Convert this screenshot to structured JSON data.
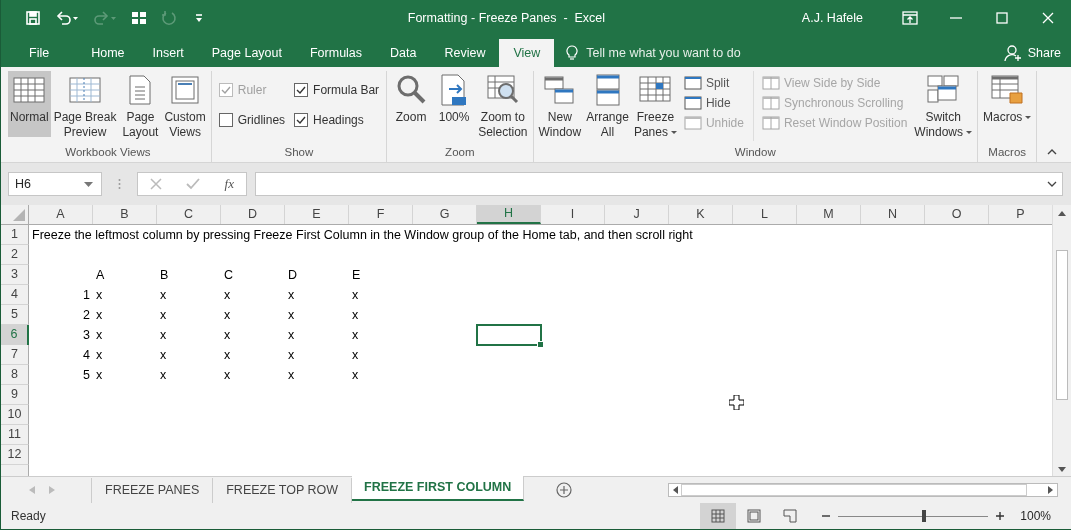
{
  "window": {
    "title": "Formatting - Freeze Panes  -  Excel",
    "user": "A.J. Hafele"
  },
  "quick_access": [
    {
      "kind": "save",
      "disabled": false
    },
    {
      "kind": "undo",
      "disabled": false
    },
    {
      "kind": "redo",
      "disabled": true
    },
    {
      "kind": "form",
      "disabled": false
    },
    {
      "kind": "refresh",
      "disabled": true
    },
    {
      "kind": "customize",
      "disabled": false
    }
  ],
  "ribbon_tabs": [
    {
      "label": "File",
      "selected": false
    },
    {
      "label": "Home",
      "selected": false
    },
    {
      "label": "Insert",
      "selected": false
    },
    {
      "label": "Page Layout",
      "selected": false
    },
    {
      "label": "Formulas",
      "selected": false
    },
    {
      "label": "Data",
      "selected": false
    },
    {
      "label": "Review",
      "selected": false
    },
    {
      "label": "View",
      "selected": true
    }
  ],
  "tell_me": {
    "placeholder": "Tell me what you want to do"
  },
  "share": "Share",
  "ribbon_groups": [
    {
      "label": "Workbook Views",
      "items": [
        {
          "kind": "large",
          "lines": [
            "Normal"
          ],
          "selected": true
        },
        {
          "kind": "large",
          "lines": [
            "Page Break",
            "Preview"
          ],
          "selected": false
        },
        {
          "kind": "large",
          "lines": [
            "Page",
            "Layout"
          ],
          "selected": false
        },
        {
          "kind": "large",
          "lines": [
            "Custom",
            "Views"
          ],
          "selected": false
        }
      ]
    },
    {
      "label": "Show",
      "items": [
        {
          "kind": "stack",
          "items": [
            {
              "label": "Ruler",
              "checked": true,
              "disabled": true
            },
            {
              "label": "Gridlines",
              "checked": false,
              "disabled": false
            }
          ]
        },
        {
          "kind": "stack",
          "items": [
            {
              "label": "Formula Bar",
              "checked": true,
              "disabled": false
            },
            {
              "label": "Headings",
              "checked": true,
              "disabled": false
            }
          ]
        }
      ]
    },
    {
      "label": "Zoom",
      "items": [
        {
          "kind": "large",
          "lines": [
            "Zoom"
          ],
          "selected": false
        },
        {
          "kind": "large",
          "lines": [
            "100%"
          ],
          "selected": false
        },
        {
          "kind": "large",
          "lines": [
            "Zoom to",
            "Selection"
          ],
          "selected": false
        }
      ]
    },
    {
      "label": "Window",
      "items": [
        {
          "kind": "large",
          "lines": [
            "New",
            "Window"
          ],
          "selected": false
        },
        {
          "kind": "large",
          "lines": [
            "Arrange",
            "All"
          ],
          "selected": false
        },
        {
          "kind": "large",
          "lines": [
            "Freeze",
            "Panes"
          ],
          "selected": false,
          "dropdown": true
        },
        {
          "kind": "small",
          "items": [
            {
              "label": "Split",
              "disabled": false
            },
            {
              "label": "Hide",
              "disabled": false
            },
            {
              "label": "Unhide",
              "disabled": true
            }
          ]
        },
        {
          "kind": "small",
          "items": [
            {
              "label": "View Side by Side",
              "disabled": true
            },
            {
              "label": "Synchronous Scrolling",
              "disabled": true
            },
            {
              "label": "Reset Window Position",
              "disabled": true
            }
          ]
        },
        {
          "kind": "large",
          "lines": [
            "Switch",
            "Windows"
          ],
          "selected": false,
          "dropdown": true
        }
      ]
    },
    {
      "label": "Macros",
      "items": [
        {
          "kind": "large",
          "lines": [
            "Macros"
          ],
          "selected": false,
          "dropdown": true
        }
      ]
    }
  ],
  "formula_bar": {
    "name_box": "H6",
    "function_button": "fx"
  },
  "columns": [
    {
      "label": "A",
      "selected": false
    },
    {
      "label": "B",
      "selected": false
    },
    {
      "label": "C",
      "selected": false
    },
    {
      "label": "D",
      "selected": false
    },
    {
      "label": "E",
      "selected": false
    },
    {
      "label": "F",
      "selected": false
    },
    {
      "label": "G",
      "selected": false
    },
    {
      "label": "H",
      "selected": true
    },
    {
      "label": "I",
      "selected": false
    },
    {
      "label": "J",
      "selected": false
    },
    {
      "label": "K",
      "selected": false
    },
    {
      "label": "L",
      "selected": false
    },
    {
      "label": "M",
      "selected": false
    },
    {
      "label": "N",
      "selected": false
    },
    {
      "label": "O",
      "selected": false
    },
    {
      "label": "P",
      "selected": false
    }
  ],
  "rows": [
    {
      "label": "1",
      "selected": false,
      "cells": [
        {
          "text": "Freeze the leftmost column by pressing Freeze First Column in the Window group of the Home tab, and then scroll right",
          "kind": "text"
        }
      ]
    },
    {
      "label": "2",
      "selected": false
    },
    {
      "label": "3",
      "selected": false,
      "cells": [
        null,
        {
          "text": "A",
          "kind": "text"
        },
        {
          "text": "B",
          "kind": "text"
        },
        {
          "text": "C",
          "kind": "text"
        },
        {
          "text": "D",
          "kind": "text"
        },
        {
          "text": "E",
          "kind": "text"
        }
      ]
    },
    {
      "label": "4",
      "selected": false,
      "cells": [
        {
          "text": "1",
          "kind": "number"
        },
        {
          "text": "x",
          "kind": "text"
        },
        {
          "text": "x",
          "kind": "text"
        },
        {
          "text": "x",
          "kind": "text"
        },
        {
          "text": "x",
          "kind": "text"
        },
        {
          "text": "x",
          "kind": "text"
        }
      ]
    },
    {
      "label": "5",
      "selected": false,
      "cells": [
        {
          "text": "2",
          "kind": "number"
        },
        {
          "text": "x",
          "kind": "text"
        },
        {
          "text": "x",
          "kind": "text"
        },
        {
          "text": "x",
          "kind": "text"
        },
        {
          "text": "x",
          "kind": "text"
        },
        {
          "text": "x",
          "kind": "text"
        }
      ]
    },
    {
      "label": "6",
      "selected": true,
      "cells": [
        {
          "text": "3",
          "kind": "number"
        },
        {
          "text": "x",
          "kind": "text"
        },
        {
          "text": "x",
          "kind": "text"
        },
        {
          "text": "x",
          "kind": "text"
        },
        {
          "text": "x",
          "kind": "text"
        },
        {
          "text": "x",
          "kind": "text"
        }
      ]
    },
    {
      "label": "7",
      "selected": false,
      "cells": [
        {
          "text": "4",
          "kind": "number"
        },
        {
          "text": "x",
          "kind": "text"
        },
        {
          "text": "x",
          "kind": "text"
        },
        {
          "text": "x",
          "kind": "text"
        },
        {
          "text": "x",
          "kind": "text"
        },
        {
          "text": "x",
          "kind": "text"
        }
      ]
    },
    {
      "label": "8",
      "selected": false,
      "cells": [
        {
          "text": "5",
          "kind": "number"
        },
        {
          "text": "x",
          "kind": "text"
        },
        {
          "text": "x",
          "kind": "text"
        },
        {
          "text": "x",
          "kind": "text"
        },
        {
          "text": "x",
          "kind": "text"
        },
        {
          "text": "x",
          "kind": "text"
        }
      ]
    },
    {
      "label": "9",
      "selected": false
    },
    {
      "label": "10",
      "selected": false
    },
    {
      "label": "11",
      "selected": false
    },
    {
      "label": "12",
      "selected": false
    }
  ],
  "sheet_tabs": [
    {
      "label": "FREEZE PANES",
      "selected": false
    },
    {
      "label": "FREEZE TOP ROW",
      "selected": false
    },
    {
      "label": "FREEZE FIRST COLUMN",
      "selected": true
    }
  ],
  "status_bar": {
    "text": "Ready",
    "views": [
      {
        "selected": true
      },
      {
        "selected": false
      },
      {
        "selected": false
      }
    ],
    "zoom": {
      "level": 0.57,
      "reading": "100%"
    }
  }
}
